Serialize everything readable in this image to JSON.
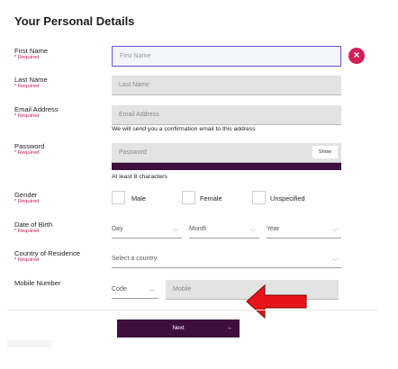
{
  "page": {
    "title": "Your Personal Details"
  },
  "required_text": "* Required",
  "first_name": {
    "label": "First Name",
    "placeholder": "First Name"
  },
  "last_name": {
    "label": "Last Name",
    "placeholder": "Last Name"
  },
  "email": {
    "label": "Email Address",
    "placeholder": "Email Address",
    "note": "We will send you a confirmation email to this address"
  },
  "password": {
    "label": "Password",
    "placeholder": "Password",
    "show_label": "Show",
    "note": "At least 8 characters"
  },
  "gender": {
    "label": "Gender",
    "options": [
      "Male",
      "Female",
      "Unspecified"
    ]
  },
  "dob": {
    "label": "Date of Birth",
    "day": "Day",
    "month": "Month",
    "year": "Year"
  },
  "country": {
    "label": "Country of Residence",
    "placeholder": "Select a country"
  },
  "mobile": {
    "label": "Mobile Number",
    "code": "Code",
    "placeholder": "Mobile"
  },
  "next_label": "Next",
  "colors": {
    "accent": "#3e0f3c",
    "required": "#d0135a",
    "error": "#d41c55",
    "arrow": "#e8141b"
  }
}
